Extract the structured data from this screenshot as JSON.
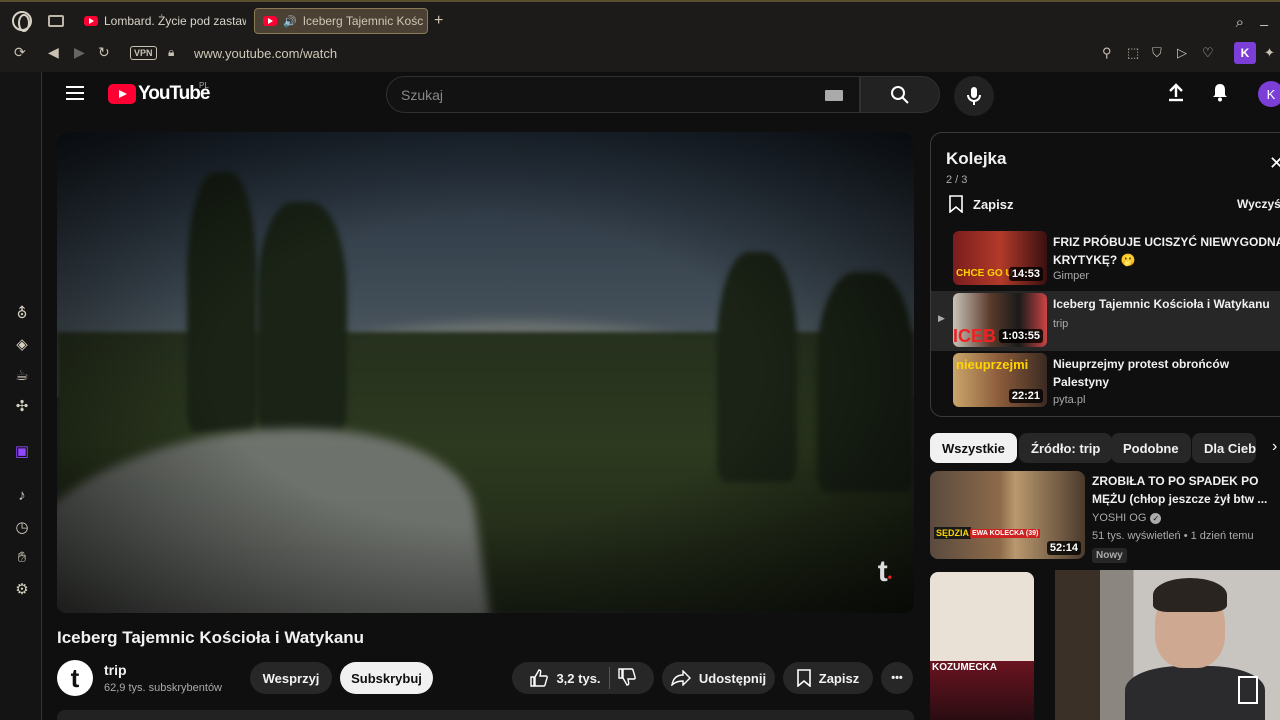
{
  "browser": {
    "tabs": [
      {
        "label": "Lombard. Życie pod zastaw",
        "active": false
      },
      {
        "label": "Iceberg Tajemnic Kośc",
        "active": true
      }
    ],
    "new_tab": "+",
    "vpn": "VPN",
    "url": "www.youtube.com/watch",
    "profile_letter": "K"
  },
  "youtube": {
    "logo_text": "YouTube",
    "region": "PL",
    "search_placeholder": "Szukaj",
    "avatar_letter": "K"
  },
  "video": {
    "title": "Iceberg Tajemnic Kościoła i Watykanu",
    "watermark": "t",
    "channel": {
      "avatar": "t",
      "name": "trip",
      "subscribers": "62,9 tys. subskrybentów"
    },
    "actions": {
      "support": "Wesprzyj",
      "subscribe": "Subskrybuj",
      "likes": "3,2 tys.",
      "share": "Udostępnij",
      "save": "Zapisz",
      "more": "•••"
    }
  },
  "queue": {
    "title": "Kolejka",
    "position": "2 / 3",
    "save_label": "Zapisz",
    "clear_label": "Wyczyść",
    "items": [
      {
        "title": "FRIZ PRÓBUJE UCISZYĆ NIEWYGODNĄ KRYTYKĘ? 🫢",
        "channel": "Gimper",
        "duration": "14:53",
        "thumb_text": "CHCE GO U",
        "playing": false
      },
      {
        "title": "Iceberg Tajemnic Kościoła i Watykanu",
        "channel": "trip",
        "duration": "1:03:55",
        "thumb_text": "ICEB",
        "playing": true
      },
      {
        "title": "Nieuprzejmy protest obrońców Palestyny",
        "channel": "pyta.pl",
        "duration": "22:21",
        "thumb_text": "nieuprzejmi",
        "playing": false
      }
    ]
  },
  "chips": [
    "Wszystkie",
    "Źródło: trip",
    "Podobne",
    "Dla Ciebie"
  ],
  "recommendations": [
    {
      "title": "ZROBIŁA TO PO SPADEK PO MĘŻU (chłop jeszcze żył btw ...",
      "channel": "YOSHI OG",
      "meta": "51 tys. wyświetleń • 1 dzień temu",
      "badge": "Nowy",
      "duration": "52:14",
      "thumb_caption": "SĘDZIA",
      "thumb_name": "EWA KOLECKA (39)"
    },
    {
      "thumb_caption": "KOZUMECKA"
    }
  ],
  "colors": {
    "yt_red": "#ff0033",
    "accent_purple": "#7b3fd8",
    "bg": "#0f0f0f"
  }
}
